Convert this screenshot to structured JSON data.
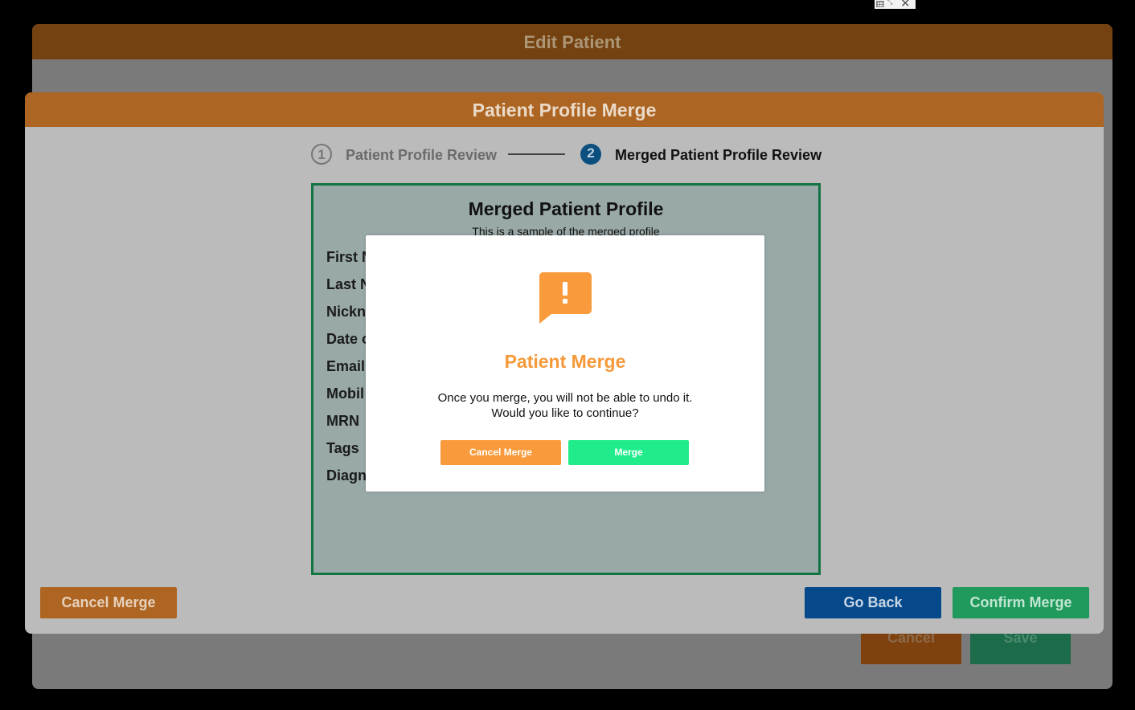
{
  "edit_patient": {
    "title": "Edit Patient",
    "cancel_label": "Cancel",
    "save_label": "Save"
  },
  "merge_modal": {
    "title": "Patient Profile Merge",
    "steps": [
      {
        "number": "1",
        "label": "Patient Profile Review"
      },
      {
        "number": "2",
        "label": "Merged Patient Profile Review"
      }
    ],
    "active_step": 2,
    "profile": {
      "title": "Merged Patient Profile",
      "subtitle": "This is a sample of the merged profile",
      "fields": [
        "First N",
        "Last N",
        "Nickn",
        "Date o",
        "Email",
        "Mobil",
        "MRN",
        "Tags",
        "Diagn"
      ]
    },
    "buttons": {
      "cancel_merge": "Cancel Merge",
      "go_back": "Go Back",
      "confirm_merge": "Confirm Merge"
    }
  },
  "dialog": {
    "icon": "alert-speech-bubble-icon",
    "title": "Patient Merge",
    "message_line1": "Once you merge, you will not be able to undo it.",
    "message_line2": "Would you like to continue?",
    "cancel_label": "Cancel Merge",
    "merge_label": "Merge",
    "accent_color": "#f5993a",
    "merge_color": "#21ec8b"
  }
}
